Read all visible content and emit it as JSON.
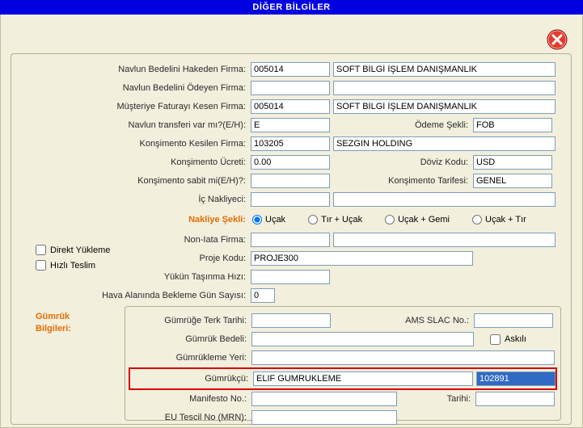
{
  "title": "DİĞER BİLGİLER",
  "labels": {
    "navlunHakeden": "Navlun Bedelini Hakeden Firma:",
    "navlunOdeyen": "Navlun Bedelini Ödeyen Firma:",
    "musteriFatura": "Müşteriye Faturayı Kesen Firma:",
    "navlunTransfer": "Navlun transferi var mı?(E/H):",
    "odemeSekli": "Ödeme Şekli:",
    "konsimentoKesilen": "Konşimento Kesilen Firma:",
    "konsimentoUcreti": "Konşimento Ücreti:",
    "dovizKodu": "Döviz Kodu:",
    "konsimentoSabit": "Konşimento sabit mi(E/H)?:",
    "konsimentoTarifesi": "Konşimento Tarifesi:",
    "icNakliyeci": "İç Nakliyeci:",
    "nakliyeSekli": "Nakliye Şekli:",
    "nonIata": "Non-Iata Firma:",
    "projeKodu": "Proje Kodu:",
    "yukunTasinmaHizi": "Yükün Taşınma Hızı:",
    "havaAlaninda": "Hava Alanında Bekleme Gün Sayısı:",
    "direktYukleme": "Direkt Yükleme",
    "hizliTeslim": "Hızlı Teslim",
    "gumrukBilgileri": "Gümrük",
    "gumrukBilgileri2": "Bilgileri:",
    "gumrugeTerkTarihi": "Gümrüğe Terk Tarihi:",
    "amsSlacNo": "AMS SLAC No.:",
    "gumrukBedeli": "Gümrük Bedeli:",
    "askili": "Askılı",
    "gumruklemeYeri": "Gümrükleme Yeri:",
    "gumrukcu": "Gümrükçü:",
    "manifestoNo": "Manifesto No.:",
    "tarihi": "Tarihi:",
    "euTescil": "EU Tescil No (MRN):"
  },
  "radios": {
    "ucak": "Uçak",
    "tirUcak": "Tır + Uçak",
    "ucakGemi": "Uçak + Gemi",
    "ucakTir": "Uçak + Tır"
  },
  "values": {
    "hakedenKod": "005014",
    "hakedenAd": "SOFT BİLGİ İŞLEM DANIŞMANLIK",
    "odeyenKod": "",
    "odeyenAd": "",
    "faturaKod": "005014",
    "faturaAd": "SOFT BİLGİ İŞLEM DANIŞMANLIK",
    "navlunTransfer": "E",
    "odemeSekli": "FOB",
    "konsKesilenKod": "103205",
    "konsKesilenAd": "SEZGIN HOLDING",
    "konsUcret": "0.00",
    "dovizKodu": "USD",
    "konsSabit": "",
    "konsTarifesi": "GENEL",
    "icNakliyeciKod": "",
    "icNakliyeciAd": "",
    "nonIataKod": "",
    "nonIataAd": "",
    "projeKodu": "PROJE300",
    "yukunTasinmaHizi": "",
    "havaAlaninda": "0",
    "gumrugeTerkTarihi": "",
    "amsSlacNo": "",
    "gumrukBedeli": "",
    "gumruklemeYeri": "",
    "gumrukcuAd": "ELIF GUMRUKLEME",
    "gumrukcuKod": "102891",
    "manifestoNo": "",
    "tarihi": "",
    "euTescil": ""
  }
}
